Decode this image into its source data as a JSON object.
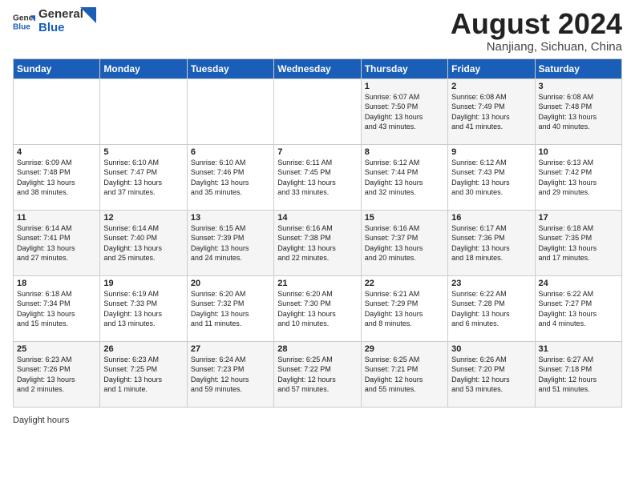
{
  "header": {
    "logo_general": "General",
    "logo_blue": "Blue",
    "title": "August 2024",
    "subtitle": "Nanjiang, Sichuan, China"
  },
  "days_of_week": [
    "Sunday",
    "Monday",
    "Tuesday",
    "Wednesday",
    "Thursday",
    "Friday",
    "Saturday"
  ],
  "weeks": [
    [
      {
        "day": "",
        "info": ""
      },
      {
        "day": "",
        "info": ""
      },
      {
        "day": "",
        "info": ""
      },
      {
        "day": "",
        "info": ""
      },
      {
        "day": "1",
        "info": "Sunrise: 6:07 AM\nSunset: 7:50 PM\nDaylight: 13 hours\nand 43 minutes."
      },
      {
        "day": "2",
        "info": "Sunrise: 6:08 AM\nSunset: 7:49 PM\nDaylight: 13 hours\nand 41 minutes."
      },
      {
        "day": "3",
        "info": "Sunrise: 6:08 AM\nSunset: 7:48 PM\nDaylight: 13 hours\nand 40 minutes."
      }
    ],
    [
      {
        "day": "4",
        "info": "Sunrise: 6:09 AM\nSunset: 7:48 PM\nDaylight: 13 hours\nand 38 minutes."
      },
      {
        "day": "5",
        "info": "Sunrise: 6:10 AM\nSunset: 7:47 PM\nDaylight: 13 hours\nand 37 minutes."
      },
      {
        "day": "6",
        "info": "Sunrise: 6:10 AM\nSunset: 7:46 PM\nDaylight: 13 hours\nand 35 minutes."
      },
      {
        "day": "7",
        "info": "Sunrise: 6:11 AM\nSunset: 7:45 PM\nDaylight: 13 hours\nand 33 minutes."
      },
      {
        "day": "8",
        "info": "Sunrise: 6:12 AM\nSunset: 7:44 PM\nDaylight: 13 hours\nand 32 minutes."
      },
      {
        "day": "9",
        "info": "Sunrise: 6:12 AM\nSunset: 7:43 PM\nDaylight: 13 hours\nand 30 minutes."
      },
      {
        "day": "10",
        "info": "Sunrise: 6:13 AM\nSunset: 7:42 PM\nDaylight: 13 hours\nand 29 minutes."
      }
    ],
    [
      {
        "day": "11",
        "info": "Sunrise: 6:14 AM\nSunset: 7:41 PM\nDaylight: 13 hours\nand 27 minutes."
      },
      {
        "day": "12",
        "info": "Sunrise: 6:14 AM\nSunset: 7:40 PM\nDaylight: 13 hours\nand 25 minutes."
      },
      {
        "day": "13",
        "info": "Sunrise: 6:15 AM\nSunset: 7:39 PM\nDaylight: 13 hours\nand 24 minutes."
      },
      {
        "day": "14",
        "info": "Sunrise: 6:16 AM\nSunset: 7:38 PM\nDaylight: 13 hours\nand 22 minutes."
      },
      {
        "day": "15",
        "info": "Sunrise: 6:16 AM\nSunset: 7:37 PM\nDaylight: 13 hours\nand 20 minutes."
      },
      {
        "day": "16",
        "info": "Sunrise: 6:17 AM\nSunset: 7:36 PM\nDaylight: 13 hours\nand 18 minutes."
      },
      {
        "day": "17",
        "info": "Sunrise: 6:18 AM\nSunset: 7:35 PM\nDaylight: 13 hours\nand 17 minutes."
      }
    ],
    [
      {
        "day": "18",
        "info": "Sunrise: 6:18 AM\nSunset: 7:34 PM\nDaylight: 13 hours\nand 15 minutes."
      },
      {
        "day": "19",
        "info": "Sunrise: 6:19 AM\nSunset: 7:33 PM\nDaylight: 13 hours\nand 13 minutes."
      },
      {
        "day": "20",
        "info": "Sunrise: 6:20 AM\nSunset: 7:32 PM\nDaylight: 13 hours\nand 11 minutes."
      },
      {
        "day": "21",
        "info": "Sunrise: 6:20 AM\nSunset: 7:30 PM\nDaylight: 13 hours\nand 10 minutes."
      },
      {
        "day": "22",
        "info": "Sunrise: 6:21 AM\nSunset: 7:29 PM\nDaylight: 13 hours\nand 8 minutes."
      },
      {
        "day": "23",
        "info": "Sunrise: 6:22 AM\nSunset: 7:28 PM\nDaylight: 13 hours\nand 6 minutes."
      },
      {
        "day": "24",
        "info": "Sunrise: 6:22 AM\nSunset: 7:27 PM\nDaylight: 13 hours\nand 4 minutes."
      }
    ],
    [
      {
        "day": "25",
        "info": "Sunrise: 6:23 AM\nSunset: 7:26 PM\nDaylight: 13 hours\nand 2 minutes."
      },
      {
        "day": "26",
        "info": "Sunrise: 6:23 AM\nSunset: 7:25 PM\nDaylight: 13 hours\nand 1 minute."
      },
      {
        "day": "27",
        "info": "Sunrise: 6:24 AM\nSunset: 7:23 PM\nDaylight: 12 hours\nand 59 minutes."
      },
      {
        "day": "28",
        "info": "Sunrise: 6:25 AM\nSunset: 7:22 PM\nDaylight: 12 hours\nand 57 minutes."
      },
      {
        "day": "29",
        "info": "Sunrise: 6:25 AM\nSunset: 7:21 PM\nDaylight: 12 hours\nand 55 minutes."
      },
      {
        "day": "30",
        "info": "Sunrise: 6:26 AM\nSunset: 7:20 PM\nDaylight: 12 hours\nand 53 minutes."
      },
      {
        "day": "31",
        "info": "Sunrise: 6:27 AM\nSunset: 7:18 PM\nDaylight: 12 hours\nand 51 minutes."
      }
    ]
  ],
  "footer": {
    "daylight_label": "Daylight hours"
  }
}
